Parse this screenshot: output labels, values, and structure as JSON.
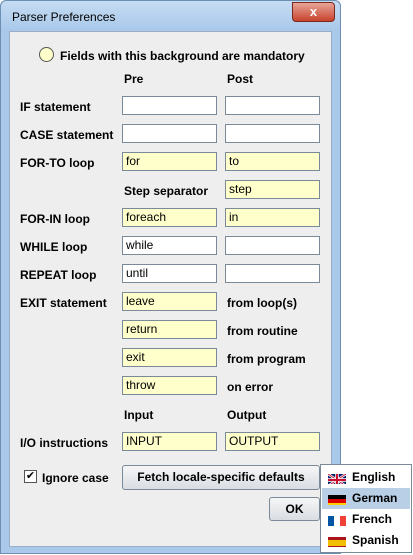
{
  "window": {
    "title": "Parser Preferences",
    "close_glyph": "x"
  },
  "legend": {
    "text": "Fields with this background are mandatory"
  },
  "columns": {
    "pre": "Pre",
    "post": "Post"
  },
  "rows": {
    "if": {
      "label": "IF statement",
      "pre": "",
      "post": ""
    },
    "case": {
      "label": "CASE statement",
      "pre": "",
      "post": ""
    },
    "forto": {
      "label": "FOR-TO loop",
      "pre": "for",
      "post": "to"
    },
    "step": {
      "label": "Step separator",
      "value": "step"
    },
    "forin": {
      "label": "FOR-IN loop",
      "pre": "foreach",
      "post": "in"
    },
    "while": {
      "label": "WHILE loop",
      "pre": "while",
      "post": ""
    },
    "repeat": {
      "label": "REPEAT loop",
      "pre": "until",
      "post": ""
    },
    "exit": {
      "label": "EXIT statement"
    },
    "exits": [
      {
        "value": "leave",
        "desc": "from loop(s)"
      },
      {
        "value": "return",
        "desc": "from routine"
      },
      {
        "value": "exit",
        "desc": "from program"
      },
      {
        "value": "throw",
        "desc": "on error"
      }
    ]
  },
  "io": {
    "input_header": "Input",
    "output_header": "Output",
    "label": "I/O instructions",
    "input": "INPUT",
    "output": "OUTPUT"
  },
  "ignore_case": {
    "label": "Ignore case",
    "checked": true,
    "mark": "✔"
  },
  "fetch_button": {
    "label": "Fetch locale-specific defaults"
  },
  "ok_button": {
    "label": "OK"
  },
  "locales": [
    {
      "label": "English",
      "flag": "uk-flag-icon"
    },
    {
      "label": "German",
      "flag": "germany-flag-icon",
      "selected": true
    },
    {
      "label": "French",
      "flag": "france-flag-icon"
    },
    {
      "label": "Spanish",
      "flag": "spain-flag-icon"
    }
  ],
  "colors": {
    "mandatory_bg": "#ffffcc",
    "selected_bg": "#b8cfe5",
    "frame": "#a9c8ea"
  }
}
